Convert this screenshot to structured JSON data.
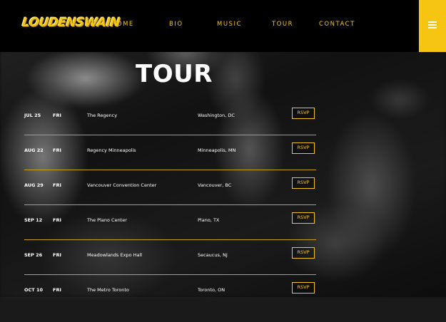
{
  "brand": {
    "logo_text": "LOUDENSWAIN",
    "accent": "#f6c511"
  },
  "nav": {
    "items": [
      {
        "label": "HOME"
      },
      {
        "label": "BIO"
      },
      {
        "label": "MUSIC"
      },
      {
        "label": "TOUR"
      },
      {
        "label": "CONTACT"
      }
    ],
    "menu_icon": "hamburger-menu-icon"
  },
  "page": {
    "title": "TOUR"
  },
  "tour": {
    "rsvp_label": "RSVP",
    "dates": [
      {
        "date": "JUL 25",
        "day": "FRI",
        "venue": "The Regency",
        "city": "Washington, DC"
      },
      {
        "date": "AUG 22",
        "day": "FRI",
        "venue": "Regency Minneapolis",
        "city": "Minneapolis, MN"
      },
      {
        "date": "AUG 29",
        "day": "FRI",
        "venue": "Vancouver Convention Center",
        "city": "Vancouver, BC"
      },
      {
        "date": "SEP 12",
        "day": "FRI",
        "venue": "The Plano Center",
        "city": "Plano, TX"
      },
      {
        "date": "SEP 26",
        "day": "FRI",
        "venue": "Meadowlands Expo Hall",
        "city": "Secaucus, NJ"
      },
      {
        "date": "OCT 10",
        "day": "FRI",
        "venue": "The Metro Toronto",
        "city": "Toronto, ON"
      }
    ]
  }
}
